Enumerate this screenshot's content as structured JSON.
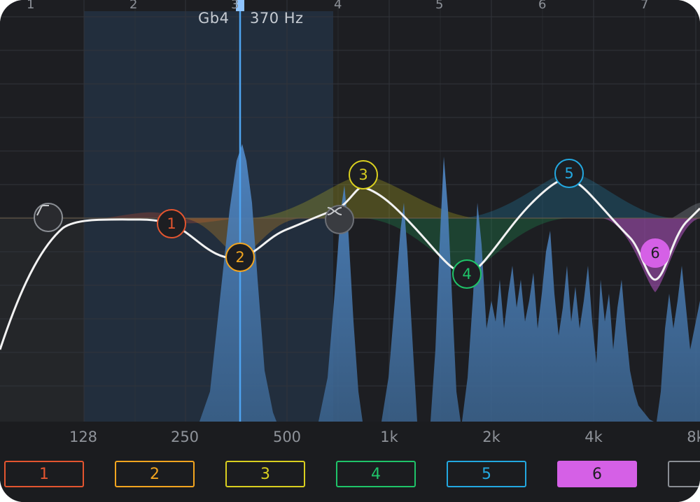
{
  "cursor": {
    "note": "Gb4",
    "frequency": "370 Hz"
  },
  "ruler": [
    "1",
    "2",
    "3",
    "4",
    "5",
    "6",
    "7"
  ],
  "freq_axis": [
    "128",
    "250",
    "500",
    "1k",
    "2k",
    "4k",
    "8k"
  ],
  "bands": [
    {
      "label": "1",
      "color": "#e4552f",
      "active": false
    },
    {
      "label": "2",
      "color": "#f3a51f",
      "active": false
    },
    {
      "label": "3",
      "color": "#d9cf1f",
      "active": false
    },
    {
      "label": "4",
      "color": "#1fc469",
      "active": false
    },
    {
      "label": "5",
      "color": "#23a8e0",
      "active": false
    },
    {
      "label": "6",
      "color": "#d560e6",
      "active": true
    },
    {
      "label": "",
      "color": "#8a8e94",
      "active": false
    }
  ],
  "nodes": [
    {
      "label": "1",
      "color": "#e4552f",
      "filled": false
    },
    {
      "label": "2",
      "color": "#f3a51f",
      "filled": false
    },
    {
      "label": "3",
      "color": "#d9cf1f",
      "filled": false
    },
    {
      "label": "4",
      "color": "#1fc469",
      "filled": false
    },
    {
      "label": "5",
      "color": "#23a8e0",
      "filled": false
    },
    {
      "label": "6",
      "color": "#d560e6",
      "filled": true
    }
  ],
  "icons": {
    "low_cut_handle": "highpass-icon",
    "bypass_handle": "crossover-icon"
  }
}
